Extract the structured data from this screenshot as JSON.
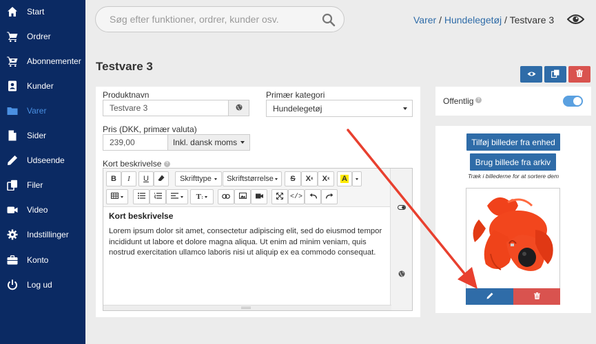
{
  "sidebar": {
    "items": [
      {
        "label": "Start",
        "icon": "home-icon"
      },
      {
        "label": "Ordrer",
        "icon": "cart-icon"
      },
      {
        "label": "Abonnementer",
        "icon": "cart-repeat-icon"
      },
      {
        "label": "Kunder",
        "icon": "contact-card-icon"
      },
      {
        "label": "Varer",
        "icon": "folder-icon",
        "active": true
      },
      {
        "label": "Sider",
        "icon": "page-icon"
      },
      {
        "label": "Udseende",
        "icon": "pencil-icon"
      },
      {
        "label": "Filer",
        "icon": "files-icon"
      },
      {
        "label": "Video",
        "icon": "video-icon"
      },
      {
        "label": "Indstillinger",
        "icon": "gear-icon"
      },
      {
        "label": "Konto",
        "icon": "briefcase-icon"
      },
      {
        "label": "Log ud",
        "icon": "power-icon"
      }
    ]
  },
  "search": {
    "placeholder": "Søg efter funktioner, ordrer, kunder osv."
  },
  "breadcrumb": {
    "items": [
      "Varer",
      "Hundelegetøj"
    ],
    "current": "Testvare 3",
    "separator": "/"
  },
  "page": {
    "title": "Testvare 3"
  },
  "colors": {
    "sidebar": "#0b2a63",
    "active": "#4a90e2",
    "primary": "#2f6ca8",
    "danger": "#d9534f",
    "toggle": "#5aa0e0",
    "arrow": "#e8402f"
  },
  "form": {
    "name_label": "Produktnavn",
    "name_value": "Testvare 3",
    "category_label": "Primær kategori",
    "category_value": "Hundelegetøj",
    "price_label": "Pris (DKK, primær valuta)",
    "price_value": "239,00",
    "vat_option": "Inkl. dansk moms",
    "short_desc_label": "Kort beskrivelse"
  },
  "editor": {
    "toolbar": {
      "font_label": "Skrifttype",
      "size_label": "Skriftstørrelse",
      "bold": "B",
      "italic": "I",
      "underline": "U",
      "superscript": "X",
      "subscript": "X"
    },
    "heading": "Kort beskrivelse",
    "text": "Lorem ipsum dolor sit amet, consectetur adipiscing elit, sed do eiusmod tempor incididunt ut labore et dolore magna aliqua. Ut enim ad minim veniam, quis nostrud exercitation ullamco laboris nisi ut aliquip ex ea commodo consequat."
  },
  "visibility": {
    "label": "Offentlig",
    "enabled": true
  },
  "images": {
    "add_device": "Tilføj billeder fra enhed",
    "add_archive": "Brug billede fra arkiv",
    "hint": "Træk i billederne for at sortere dem"
  }
}
